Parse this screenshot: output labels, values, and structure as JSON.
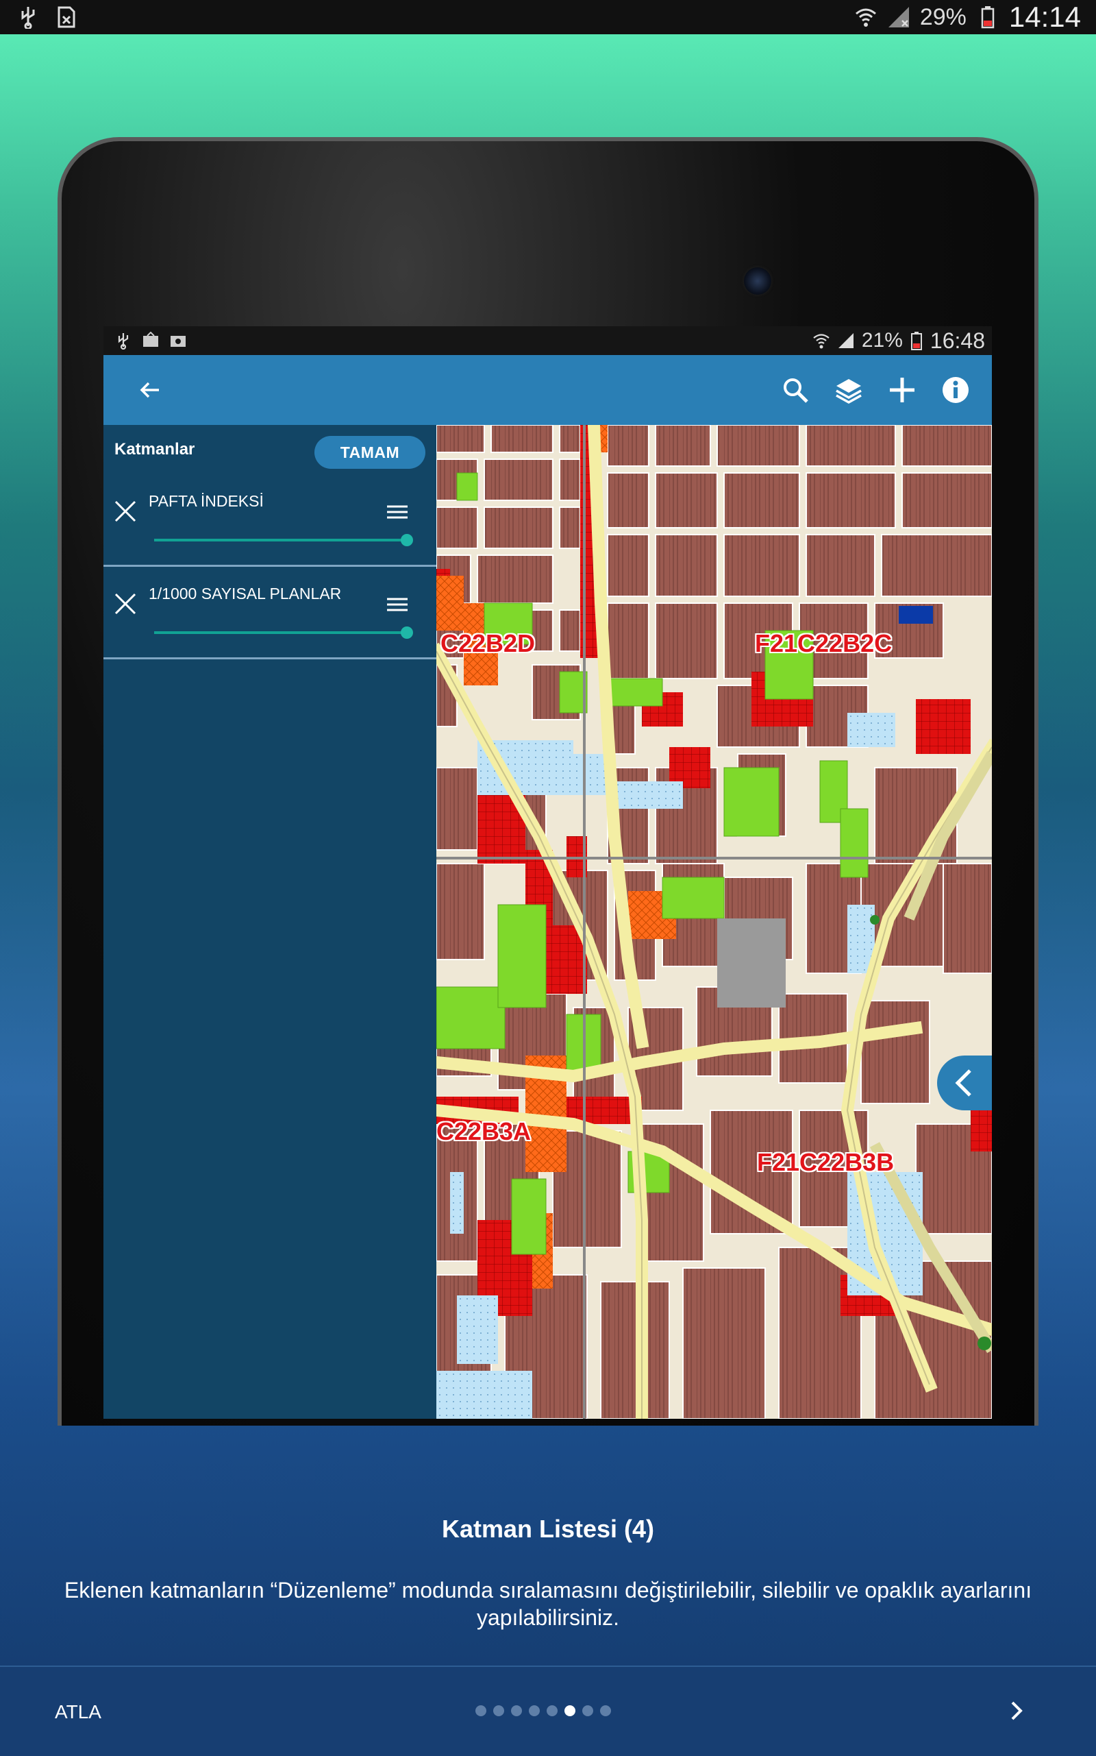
{
  "status_bar": {
    "battery": "29%",
    "time": "14:14"
  },
  "inner_status_bar": {
    "battery": "21%",
    "time": "16:48"
  },
  "app_bar": {
    "icons": [
      "back-arrow-icon",
      "search-icon",
      "layers-icon",
      "add-icon",
      "info-icon"
    ]
  },
  "layers_panel": {
    "title": "Katmanlar",
    "done_label": "TAMAM",
    "layers": [
      {
        "name": "PAFTA İNDEKSİ",
        "opacity": 1.0
      },
      {
        "name": "1/1000 SAYISAL PLANLAR",
        "opacity": 1.0
      }
    ]
  },
  "map": {
    "sheet_labels": [
      "C22B2D",
      "F21C22B2C",
      "C22B3A",
      "F21C22B3B"
    ]
  },
  "onboarding": {
    "title": "Katman Listesi (4)",
    "description": "Eklenen katmanların “Düzenleme” modunda sıralamasını değiştirilebilir, silebilir ve opaklık ayarlarını yapılabilirsiniz.",
    "skip_label": "ATLA",
    "page_count": 8,
    "current_page": 6
  },
  "colors": {
    "app_bar": "#2a7fb5",
    "panel": "#124565",
    "sheet_label": "#e2141a",
    "slider": "#11a294"
  }
}
